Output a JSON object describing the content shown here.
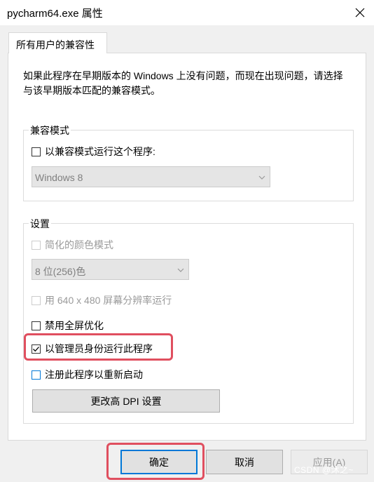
{
  "window": {
    "title": "pycharm64.exe 属性"
  },
  "tabs": [
    {
      "label": "所有用户的兼容性"
    }
  ],
  "description": "如果此程序在早期版本的 Windows 上没有问题，而现在出现问题，请选择与该早期版本匹配的兼容模式。",
  "compat_mode": {
    "legend": "兼容模式",
    "checkbox_label": "以兼容模式运行这个程序:",
    "checked": false,
    "os_select_value": "Windows 8"
  },
  "settings": {
    "legend": "设置",
    "reduced_color": {
      "label": "简化的颜色模式",
      "checked": false,
      "enabled": false
    },
    "color_select_value": "8 位(256)色",
    "res_640": {
      "label": "用 640 x 480 屏幕分辨率运行",
      "checked": false,
      "enabled": false
    },
    "disable_fullscreen": {
      "label": "禁用全屏优化",
      "checked": false
    },
    "run_as_admin": {
      "label": "以管理员身份运行此程序",
      "checked": true
    },
    "register_restart": {
      "label": "注册此程序以重新启动",
      "checked": false
    },
    "change_dpi_label": "更改高 DPI 设置"
  },
  "footer": {
    "ok_label": "确定",
    "cancel_label": "取消",
    "apply_label": "应用(A)"
  },
  "watermark": "CSDN @沐之~",
  "colors": {
    "highlight": "#e04f5f",
    "accent": "#0078d7"
  },
  "icons": [
    "close-icon",
    "chevron-down-icon",
    "checkmark-icon"
  ]
}
